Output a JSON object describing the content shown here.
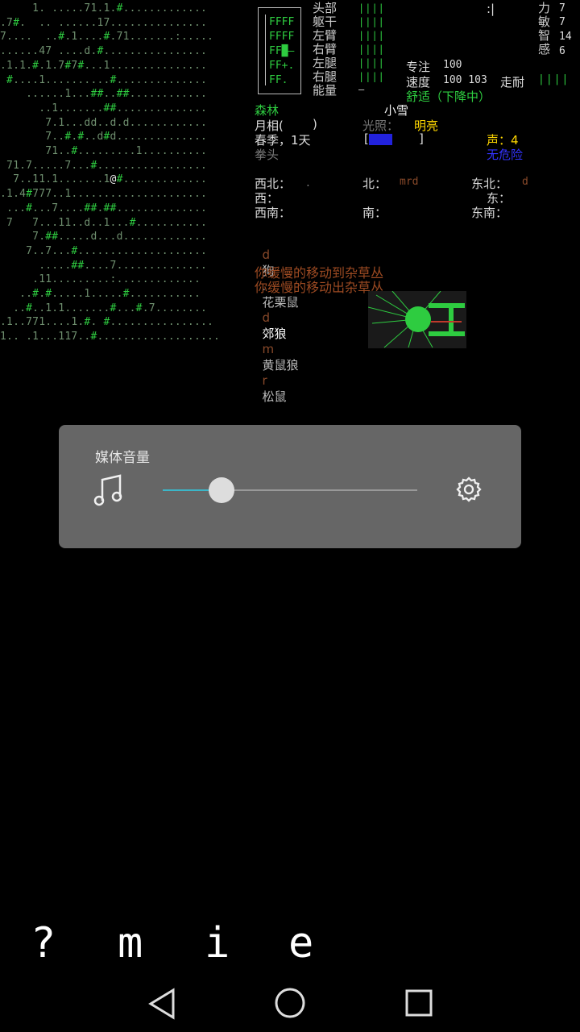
{
  "map": {
    "lines": [
      "     1. .....71.1.#.............",
      ".7#.  .. ......17...............",
      "7....  ..#.1....#.71.......:.....",
      "......47 ....d.#................",
      ".1.1.#.1.7#7#...1...............",
      " #....1..........#..............",
      "    ......1...##..##............",
      "      ..1.......##..............",
      "       7.1...dd..d.d............",
      "       7..#.#..d#d..............",
      "       71..#.........1..........",
      " 71.7.....7...#.................",
      "  7..11.1.......1@#.............",
      ".1.4#777..1.....................",
      " ...#...7....##.##..............",
      " 7   7...11..d..1...#...........",
      "     7.##.....d...d.............",
      "    7..7...#....................",
      "      .....##....7..............",
      "     .11.........:.............",
      "   ..#.#.....1.....#...........",
      "  ..#..1.1.......#...#.7........",
      ".1..771....1.#. #................",
      "1.. .1...117..#..................."
    ]
  },
  "body_panel": {
    "rows": [
      "FFFF",
      "FFFF",
      "FF█—",
      "FF+.",
      "FF. "
    ]
  },
  "body_labels": [
    "头部",
    "躯干",
    "左臂",
    "右臂",
    "左腿",
    "右腿",
    "能量"
  ],
  "bars": [
    "||||",
    "||||",
    "||||",
    "||||",
    "||||",
    "||||",
    "—"
  ],
  "stats": [
    {
      "label": "力",
      "value": "7"
    },
    {
      "label": "敏",
      "value": "7"
    },
    {
      "label": "智",
      "value": "14"
    },
    {
      "label": "感",
      "value": "6"
    }
  ],
  "status": {
    "cursor": ":|",
    "focus_label": "专注",
    "focus_value": "100",
    "speed_label": "速度",
    "speed_value": "100 103",
    "stamina_label": "走耐",
    "stamina_bars": "||||",
    "comfort": "舒适（下降中）"
  },
  "env": {
    "terrain": "森林",
    "weather": "小雪",
    "moon_label": "月相(",
    "moon_close": ")",
    "light_label": "光照：",
    "light_value": "明亮",
    "season": "春季，1天",
    "sound_label": "声：4",
    "weapon": "拳头",
    "no_hint": "无危险"
  },
  "directions": {
    "nw": "西北：",
    "nw_val": ".",
    "n": "北：",
    "n_val": "mrd",
    "ne": "东北：",
    "ne_val": "d",
    "w": "西：",
    "e": "东：",
    "sw": "西南：",
    "s": "南：",
    "se": "东南："
  },
  "creatures": [
    {
      "glyph": "d",
      "name": "狗"
    },
    {
      "glyph": ".",
      "name": "花栗鼠"
    },
    {
      "glyph": "d",
      "name": "郊狼"
    },
    {
      "glyph": "m",
      "name": "黄鼠狼"
    },
    {
      "glyph": "r",
      "name": "松鼠"
    }
  ],
  "messages": [
    "你缓慢的移动到杂草丛",
    "你缓慢的移动出杂草丛"
  ],
  "volume": {
    "title": "媒体音量",
    "level": 0.23
  },
  "keys": [
    "?",
    "m",
    "i",
    "e"
  ],
  "colors": {
    "accent": "#3bb6c8",
    "dialog_bg": "#666666",
    "map_green": "#2ecc40"
  }
}
